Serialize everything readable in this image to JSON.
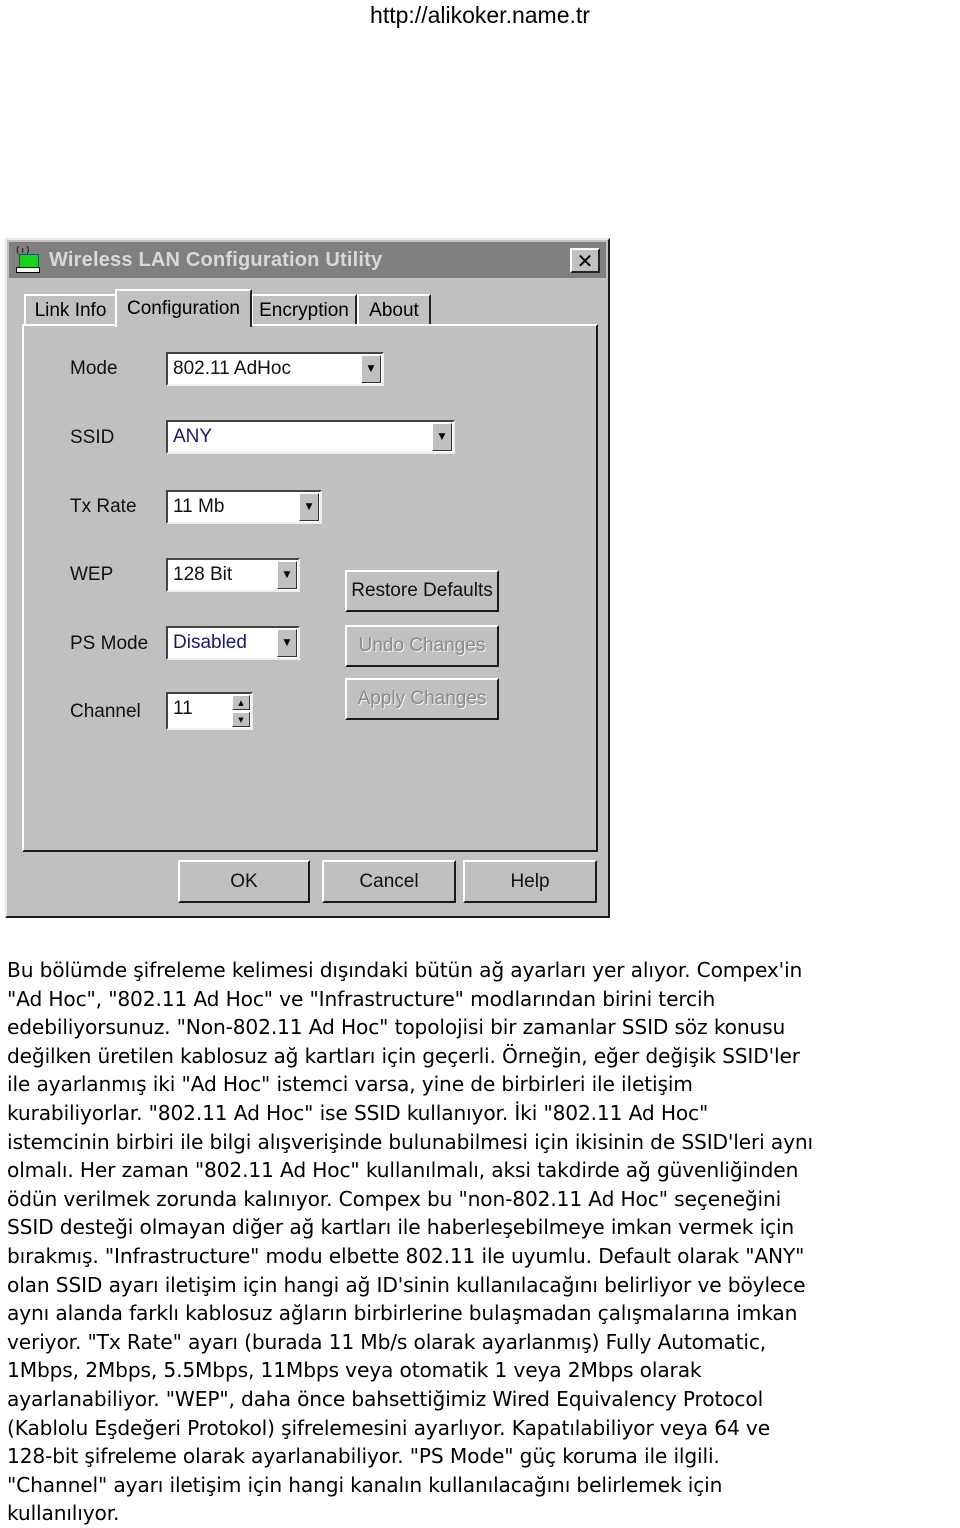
{
  "header": {
    "url": "http://alikoker.name.tr"
  },
  "window": {
    "title": "Wireless LAN Configuration Utility",
    "icon": "wireless-network-icon",
    "close_glyph": "✕",
    "tabs": [
      {
        "label": "Link Info",
        "active": false
      },
      {
        "label": "Configuration",
        "active": true
      },
      {
        "label": "Encryption",
        "active": false
      },
      {
        "label": "About",
        "active": false
      }
    ],
    "fields": {
      "mode": {
        "label": "Mode",
        "value": "802.11 AdHoc"
      },
      "ssid": {
        "label": "SSID",
        "value": "ANY"
      },
      "tx_rate": {
        "label": "Tx Rate",
        "value": "11 Mb"
      },
      "wep": {
        "label": "WEP",
        "value": "128 Bit"
      },
      "ps_mode": {
        "label": "PS Mode",
        "value": "Disabled"
      },
      "channel": {
        "label": "Channel",
        "value": "11"
      }
    },
    "side_buttons": {
      "restore": "Restore Defaults",
      "undo": "Undo Changes",
      "apply": "Apply Changes"
    },
    "bottom_buttons": {
      "ok": "OK",
      "cancel": "Cancel",
      "help": "Help"
    },
    "glyphs": {
      "dropdown": "▼",
      "spin_up": "▲",
      "spin_down": "▼"
    }
  },
  "article": {
    "lines": [
      "Bu bölümde şifreleme kelimesi dışındaki bütün ağ ayarları yer alıyor. Compex'in",
      "\"Ad Hoc\", \"802.11 Ad Hoc\" ve \"Infrastructure\" modlarından birini tercih",
      "edebiliyorsunuz. \"Non-802.11 Ad Hoc\" topolojisi bir zamanlar SSID söz konusu",
      "değilken üretilen kablosuz ağ kartları için geçerli. Örneğin, eğer değişik SSID'ler",
      "ile ayarlanmış iki \"Ad Hoc\" istemci varsa, yine de birbirleri ile iletişim",
      "kurabiliyorlar. \"802.11 Ad Hoc\" ise SSID kullanıyor. İki \"802.11 Ad Hoc\"",
      "istemcinin birbiri ile bilgi alışverişinde bulunabilmesi için ikisinin de SSID'leri aynı",
      "olmalı. Her zaman \"802.11 Ad Hoc\" kullanılmalı, aksi takdirde ağ güvenliğinden",
      "ödün verilmek zorunda kalınıyor. Compex bu \"non-802.11 Ad Hoc\" seçeneğini",
      "SSID desteği olmayan diğer ağ kartları ile haberleşebilmeye imkan vermek için",
      "bırakmış. \"Infrastructure\" modu elbette 802.11 ile uyumlu. Default olarak \"ANY\"",
      "olan SSID ayarı iletişim için hangi ağ ID'sinin kullanılacağını belirliyor ve böylece",
      "aynı alanda farklı kablosuz ağların birbirlerine bulaşmadan çalışmalarına imkan",
      "veriyor. \"Tx Rate\" ayarı (burada 11 Mb/s olarak ayarlanmış) Fully Automatic,",
      "1Mbps, 2Mbps, 5.5Mbps, 11Mbps veya otomatik 1 veya 2Mbps olarak",
      "ayarlanabiliyor. \"WEP\", daha önce bahsettiğimiz Wired Equivalency Protocol",
      "(Kablolu Eşdeğeri Protokol) şifrelemesini ayarlıyor. Kapatılabiliyor veya 64 ve",
      "128-bit şifreleme olarak ayarlanabiliyor. \"PS Mode\" güç koruma ile ilgili.",
      "\"Channel\" ayarı iletişim için hangi kanalın kullanılacağını belirlemek için",
      "kullanılıyor."
    ]
  }
}
